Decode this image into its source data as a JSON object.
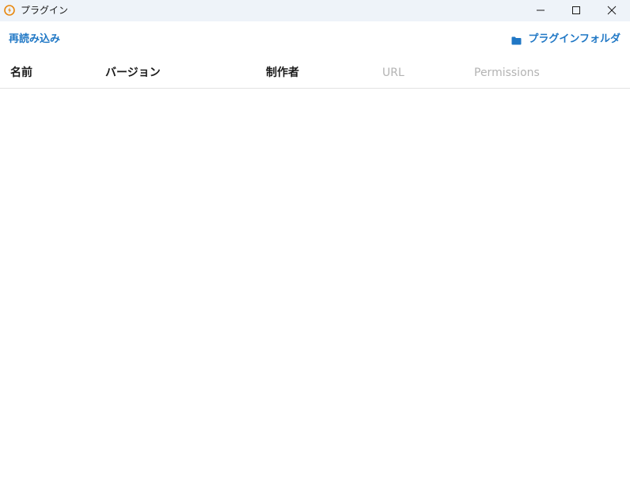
{
  "window": {
    "title": "プラグイン",
    "accent_color": "#1f77c5",
    "icon": "plugin-app-icon"
  },
  "toolbar": {
    "reload_label": "再読み込み",
    "plugin_folder_label": "プラグインフォルダ",
    "folder_icon": "folder-icon"
  },
  "table": {
    "columns": [
      {
        "label": "名前"
      },
      {
        "label": "バージョン"
      },
      {
        "label": "制作者"
      },
      {
        "label": "URL"
      },
      {
        "label": "Permissions"
      }
    ],
    "rows": []
  }
}
